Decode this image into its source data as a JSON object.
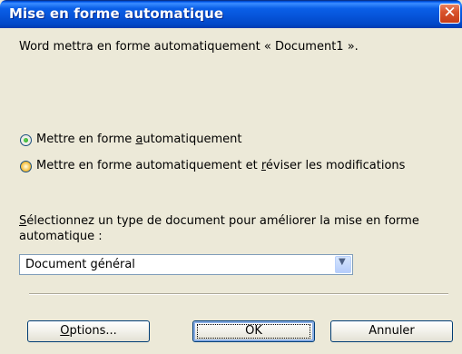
{
  "window": {
    "title": "Mise en forme automatique",
    "close_glyph": "✕"
  },
  "intro": "Word mettra en forme automatiquement « Document1 ».",
  "options": [
    {
      "pre": "Mettre en forme ",
      "accel": "a",
      "post": "utomatiquement",
      "selected": true
    },
    {
      "pre": "Mettre en forme automatiquement et ",
      "accel": "r",
      "post": "éviser les modifications",
      "selected": false
    }
  ],
  "doc_type": {
    "prompt_accel": "S",
    "prompt_rest": "électionnez un type de document pour améliorer la mise en forme",
    "prompt_line2": "automatique :",
    "selected": "Document général",
    "dropdown_glyph": "▼"
  },
  "buttons": {
    "options_accel": "O",
    "options_rest": "ptions...",
    "ok": "OK",
    "cancel": "Annuler"
  },
  "colors": {
    "titlebar": "#0054e3",
    "close": "#d9542d",
    "dialog_bg": "#ece9d8"
  }
}
